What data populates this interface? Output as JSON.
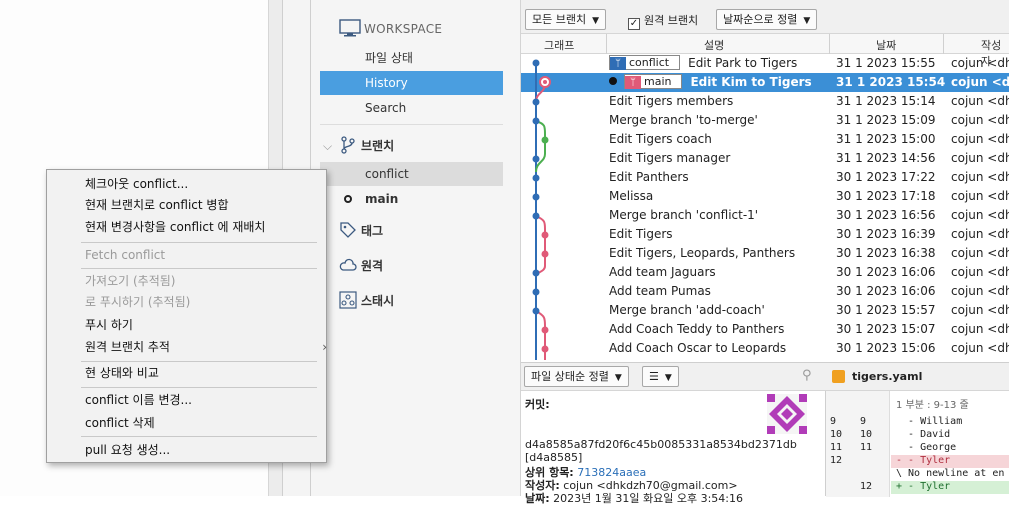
{
  "sidebar": {
    "workspace_header": "WORKSPACE",
    "items": [
      {
        "label": "파일 상태"
      },
      {
        "label": "History"
      },
      {
        "label": "Search"
      }
    ],
    "branches_label": "브랜치",
    "branch_items": [
      {
        "label": "conflict"
      },
      {
        "label": "main"
      }
    ],
    "tags_label": "태그",
    "remotes_label": "원격",
    "stash_label": "스태시"
  },
  "toolbar": {
    "branch_filter": "모든 브랜치",
    "remote_branch_label": "원격 브랜치",
    "remote_branch_checked": true,
    "sort_label": "날짜순으로 정렬"
  },
  "columns": {
    "graph": "그래프",
    "description": "설명",
    "date": "날짜",
    "author": "작성자"
  },
  "commits": [
    {
      "tag": "conflict",
      "desc": "Edit Park to Tigers",
      "date": "31 1 2023 15:55",
      "author": "cojun <dhk"
    },
    {
      "tag": "main",
      "desc": "Edit Kim to Tigers",
      "date": "31 1 2023 15:54",
      "author": "cojun <dhk"
    },
    {
      "desc": "Edit Tigers members",
      "date": "31 1 2023 15:14",
      "author": "cojun <dhk"
    },
    {
      "desc": "Merge branch 'to-merge'",
      "date": "31 1 2023 15:09",
      "author": "cojun <dhk"
    },
    {
      "desc": "Edit Tigers coach",
      "date": "31 1 2023 15:00",
      "author": "cojun <dhk"
    },
    {
      "desc": "Edit Tigers manager",
      "date": "31 1 2023 14:56",
      "author": "cojun <dhk"
    },
    {
      "desc": "Edit Panthers",
      "date": "30 1 2023 17:22",
      "author": "cojun <dhk"
    },
    {
      "desc": "Melissa",
      "date": "30 1 2023 17:18",
      "author": "cojun <dhk"
    },
    {
      "desc": "Merge branch 'conflict-1'",
      "date": "30 1 2023 16:56",
      "author": "cojun <dhk"
    },
    {
      "desc": "Edit Tigers",
      "date": "30 1 2023 16:39",
      "author": "cojun <dhk"
    },
    {
      "desc": "Edit Tigers, Leopards, Panthers",
      "date": "30 1 2023 16:38",
      "author": "cojun <dhk"
    },
    {
      "desc": "Add team Jaguars",
      "date": "30 1 2023 16:06",
      "author": "cojun <dhk"
    },
    {
      "desc": "Add team Pumas",
      "date": "30 1 2023 16:06",
      "author": "cojun <dhk"
    },
    {
      "desc": "Merge branch 'add-coach'",
      "date": "30 1 2023 15:57",
      "author": "cojun <dhk"
    },
    {
      "desc": "Add Coach Teddy to Panthers",
      "date": "30 1 2023 15:07",
      "author": "cojun <dhk"
    },
    {
      "desc": "Add Coach Oscar to Leopards",
      "date": "30 1 2023 15:06",
      "author": "cojun <dhk"
    }
  ],
  "detail": {
    "sort_label": "파일 상태순 정렬",
    "commit_label": "커밋:",
    "hash": "d4a8585a87fd20f6c45b0085331a8534bd2371db",
    "short_hash": "[d4a8585]",
    "parent_label": "상위 항목:",
    "parent_hash": "713824aaea",
    "author_label": "작성자:",
    "author_value": "cojun <dhkdzh70@gmail.com>",
    "date_label": "날짜:",
    "date_value": "2023년 1월 31일 화요일 오후 3:54:16"
  },
  "diff": {
    "filename": "tigers.yaml",
    "hunk": "1 부분 : 9-13 줄",
    "lines": [
      {
        "old": "9",
        "new": "9",
        "text": "  - William",
        "kind": "ctx"
      },
      {
        "old": "10",
        "new": "10",
        "text": "  - David",
        "kind": "ctx"
      },
      {
        "old": "11",
        "new": "11",
        "text": "  - George",
        "kind": "ctx"
      },
      {
        "old": "12",
        "new": "",
        "text": "- - Tyler",
        "kind": "del"
      },
      {
        "old": "",
        "new": "",
        "text": "\\ No newline at en",
        "kind": "ctx"
      },
      {
        "old": "",
        "new": "12",
        "text": "+ - Tyler",
        "kind": "add"
      }
    ]
  },
  "context_menu": {
    "items": [
      {
        "label": "체크아웃 conflict...",
        "disabled": false
      },
      {
        "label": "현재 브랜치로 conflict 병합",
        "disabled": false
      },
      {
        "label": "현재 변경사항을 conflict 에 재배치",
        "disabled": false
      },
      {
        "label": "Fetch conflict",
        "disabled": true
      },
      {
        "label": "가져오기  (추적됨)",
        "disabled": true
      },
      {
        "label": "로 푸시하기 (추적됨)",
        "disabled": true
      },
      {
        "label": "푸시 하기",
        "disabled": false
      },
      {
        "label": "원격 브랜치 추적",
        "disabled": false
      },
      {
        "label": "현 상태와 비교",
        "disabled": false
      },
      {
        "label": "conflict 이름 변경...",
        "disabled": false
      },
      {
        "label": "conflict 삭제",
        "disabled": false
      },
      {
        "label": "pull 요청 생성...",
        "disabled": false
      }
    ]
  },
  "colors": {
    "selection": "#3b8fd6",
    "sidebar_selection": "#4a9ee0",
    "graph_blue": "#2f6db5",
    "graph_green": "#4caf50",
    "graph_pink": "#e05a78"
  }
}
